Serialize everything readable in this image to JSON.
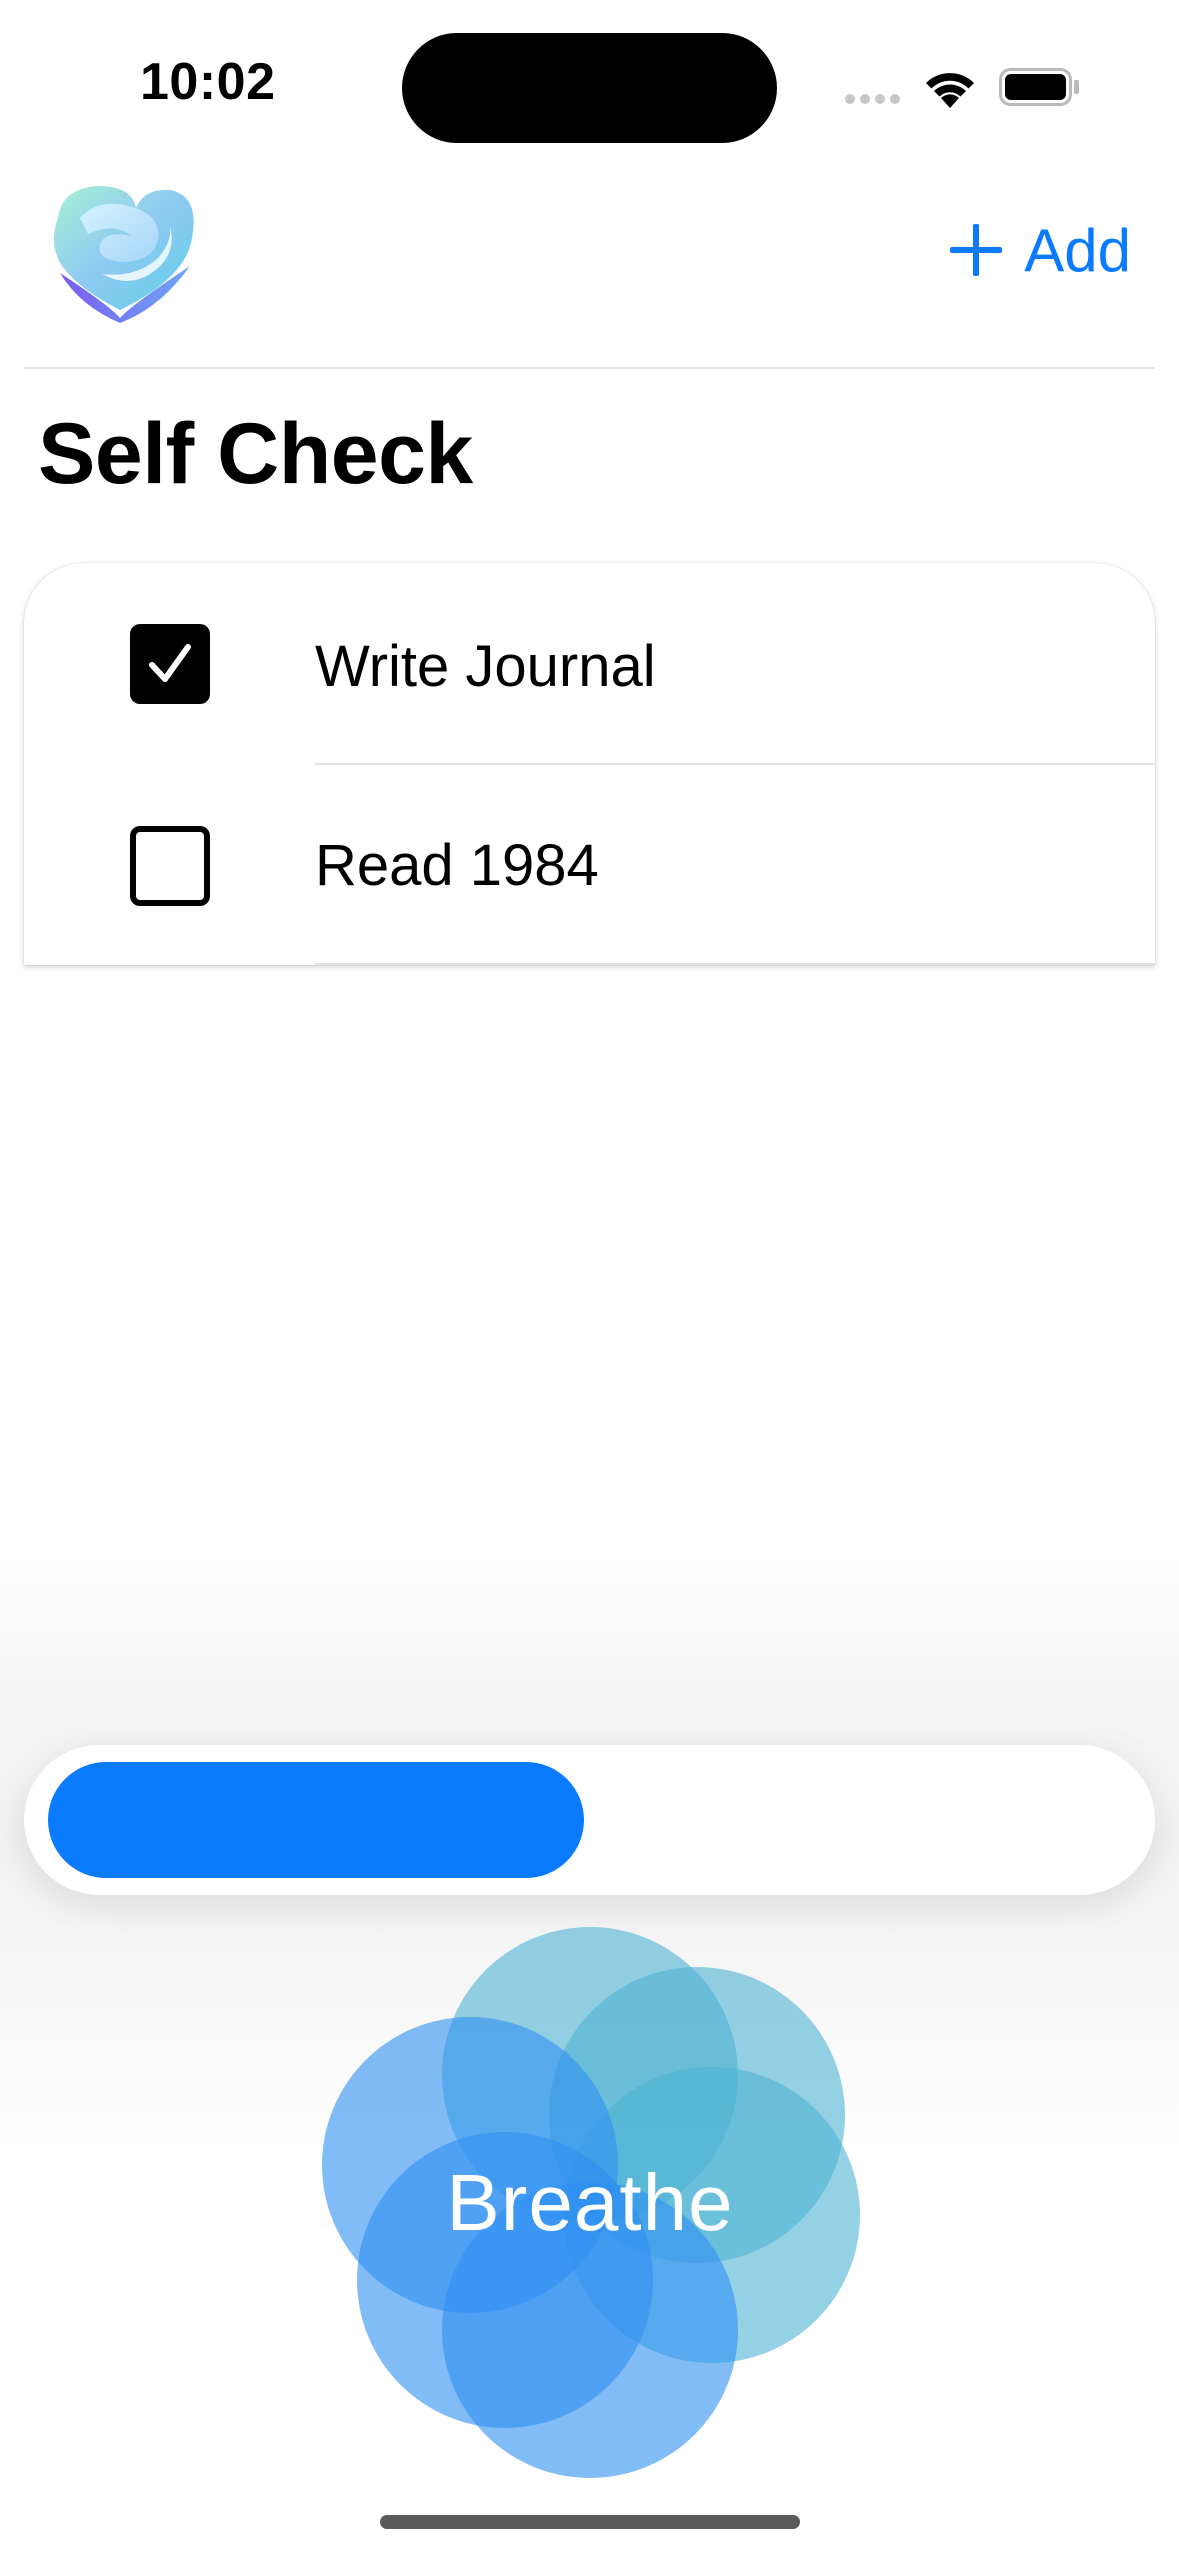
{
  "status_bar": {
    "time": "10:02"
  },
  "header": {
    "add_label": "Add",
    "icons": {
      "logo": "heart-logo",
      "add": "plus-icon"
    }
  },
  "page": {
    "title": "Self Check"
  },
  "checklist": {
    "items": [
      {
        "label": "Write Journal",
        "checked": true
      },
      {
        "label": "Read 1984",
        "checked": false
      }
    ]
  },
  "progress": {
    "fraction": 0.5
  },
  "breathe": {
    "label": "Breathe"
  },
  "colors": {
    "accent": "#0a7aff",
    "breathe_teal": "#4fb3d4",
    "breathe_blue": "#2f8ff2"
  }
}
